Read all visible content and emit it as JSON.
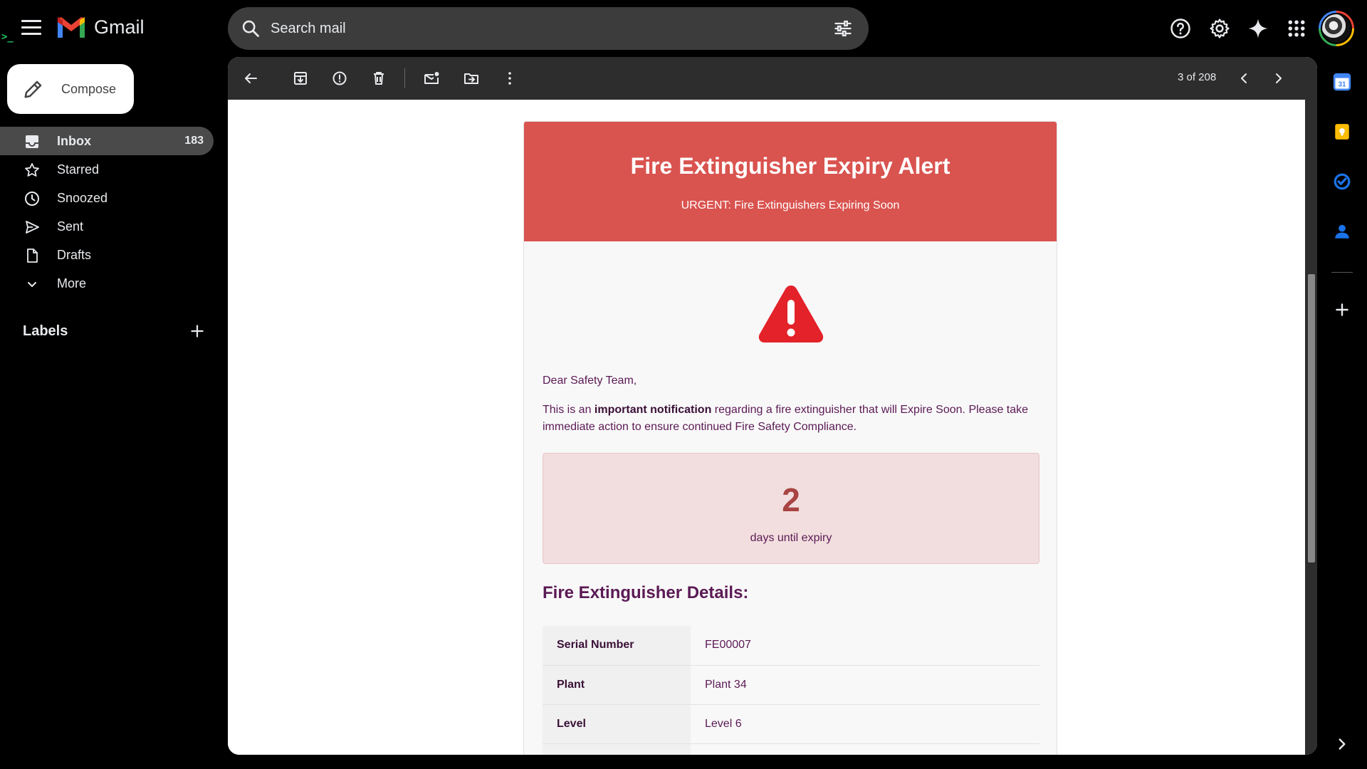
{
  "app": {
    "name": "Gmail"
  },
  "search": {
    "placeholder": "Search mail"
  },
  "compose": {
    "label": "Compose"
  },
  "sidebar": {
    "items": [
      {
        "label": "Inbox",
        "count": "183"
      },
      {
        "label": "Starred"
      },
      {
        "label": "Snoozed"
      },
      {
        "label": "Sent"
      },
      {
        "label": "Drafts"
      },
      {
        "label": "More"
      }
    ],
    "labels_heading": "Labels"
  },
  "toolbar": {
    "pager": "3 of 208"
  },
  "email": {
    "title": "Fire Extinguisher Expiry Alert",
    "subtitle": "URGENT: Fire Extinguishers Expiring Soon",
    "greeting": "Dear Safety Team,",
    "para_before": "This is an ",
    "para_bold": "important notification",
    "para_after": " regarding a fire extinguisher that will Expire Soon. Please take immediate action to ensure continued Fire Safety Compliance.",
    "countdown_value": "2",
    "countdown_caption": "days until expiry",
    "details_heading": "Fire Extinguisher Details:",
    "details": [
      {
        "key": "Serial Number",
        "value": "FE00007"
      },
      {
        "key": "Plant",
        "value": "Plant 34"
      },
      {
        "key": "Level",
        "value": "Level 6"
      }
    ]
  },
  "colors": {
    "header_red": "#d9534f",
    "alert_box_bg": "#f2dede",
    "count_red": "#a94442",
    "text_purple": "#5b1a55",
    "warning_icon_red": "#e3222a"
  },
  "icons": [
    "menu-icon",
    "gmail-logo",
    "search-icon",
    "filter-icon",
    "help-icon",
    "settings-icon",
    "gemini-icon",
    "apps-icon",
    "back-icon",
    "archive-icon",
    "report-spam-icon",
    "delete-icon",
    "mark-unread-icon",
    "move-to-icon",
    "more-icon",
    "chevron-left-icon",
    "chevron-right-icon",
    "calendar-icon",
    "keep-icon",
    "tasks-icon",
    "contacts-icon",
    "add-icon",
    "warning-icon"
  ]
}
